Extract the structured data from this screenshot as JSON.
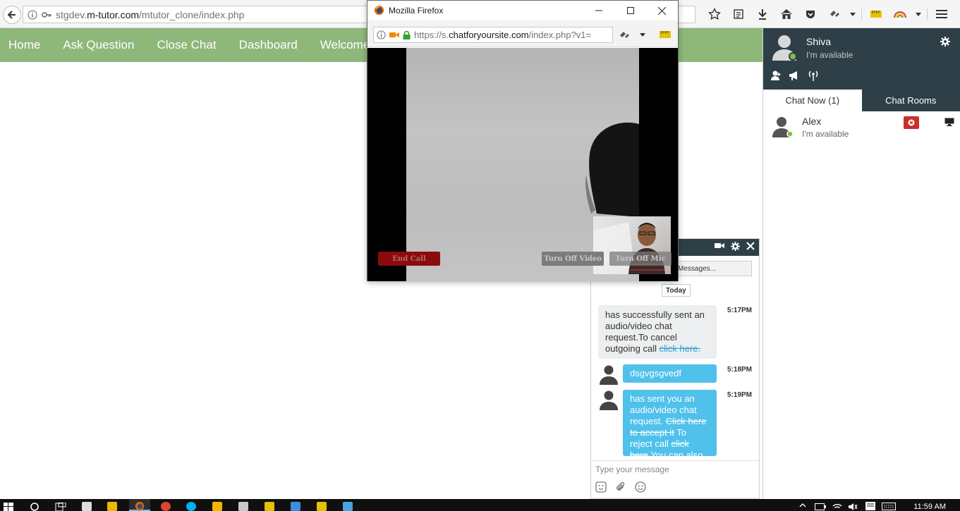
{
  "browser": {
    "url_prefix": "stgdev.",
    "url_domain": "m-tutor.com",
    "url_path": "/mtutor_clone/index.php"
  },
  "site_nav": {
    "items": [
      "Home",
      "Ask Question",
      "Close Chat",
      "Dashboard",
      "Welcome sh"
    ]
  },
  "popup": {
    "title": "Mozilla Firefox",
    "url_prefix": "https://s.",
    "url_domain": "chatforyoursite.com",
    "url_path": "/index.php?v1=",
    "buttons": {
      "end_call": "End Call",
      "turn_off_video": "Turn Off Video",
      "turn_off_mic": "Turn Off Mic"
    }
  },
  "sidebar": {
    "user_name": "Shiva",
    "user_status": "I'm available",
    "tabs": [
      "Chat Now (1)",
      "Chat Rooms"
    ],
    "contacts": [
      {
        "name": "Alex",
        "status": "I'm available"
      }
    ]
  },
  "chat": {
    "older_messages": "Messages...",
    "date_label": "Today",
    "messages": [
      {
        "text": "has successfully sent an audio/video chat request.To cancel outgoing call ",
        "link": "click here.",
        "time": "5:17PM"
      },
      {
        "text": "dsgvgsgvedf",
        "time": "5:18PM"
      },
      {
        "text_a": "has sent you an audio/video chat request. ",
        "strike_a": "Click here to accept it",
        "text_b": " To reject call ",
        "strike_b": "click here",
        "text_c": " You can also",
        "time": "5:19PM"
      }
    ],
    "input_placeholder": "Type your message"
  },
  "taskbar": {
    "time": "11:59 AM"
  },
  "colors": {
    "nav_green": "#8db87a",
    "sidebar_dark": "#2e3f47",
    "bubble_blue": "#4fc1ea",
    "online_green": "#7cc242",
    "remove_red": "#c9302c"
  }
}
